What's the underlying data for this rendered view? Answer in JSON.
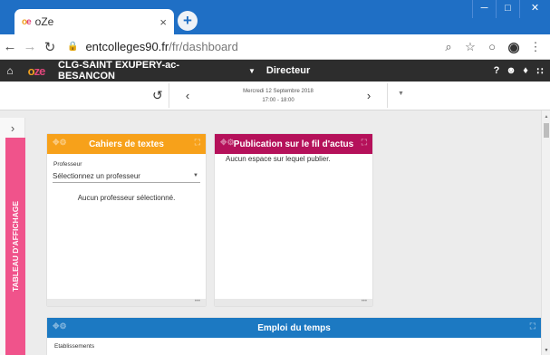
{
  "browser": {
    "tab_title": "oZe",
    "tab_close": "×",
    "new_tab": "+",
    "url_host": "entcolleges90.fr",
    "url_path": "/fr/dashboard"
  },
  "app": {
    "school": "CLG-SAINT EXUPERY-ac-BESANCON",
    "role": "Directeur"
  },
  "datebar": {
    "date": "Mercredi 12 Septembre 2018",
    "time": "17:00 - 18:00"
  },
  "sidebar": {
    "label": "TABLEAU D'AFFICHAGE"
  },
  "widgets": {
    "cahiers": {
      "title": "Cahiers de textes",
      "field_label": "Professeur",
      "select_value": "Sélectionnez un professeur",
      "empty": "Aucun professeur sélectionné."
    },
    "publication": {
      "title": "Publication sur le fil d'actus",
      "message": "Aucun espace sur lequel publier."
    },
    "emploi": {
      "title": "Emploi du temps",
      "field_label": "Etablissements"
    }
  },
  "icons": [
    "chrome-back",
    "chrome-forward",
    "reload",
    "lock",
    "zoom",
    "star",
    "extension",
    "account",
    "menu",
    "home",
    "help",
    "user",
    "bell",
    "grid",
    "refresh",
    "chevron-left",
    "chevron-right",
    "caret-down",
    "move",
    "fullscreen"
  ],
  "colors": {
    "browser_frame": "#1f6fc5",
    "app_header": "#2d2d2d",
    "orange": "#f7a11a",
    "magenta": "#b5115a",
    "blue": "#1c79c2",
    "pink": "#f0538b"
  }
}
